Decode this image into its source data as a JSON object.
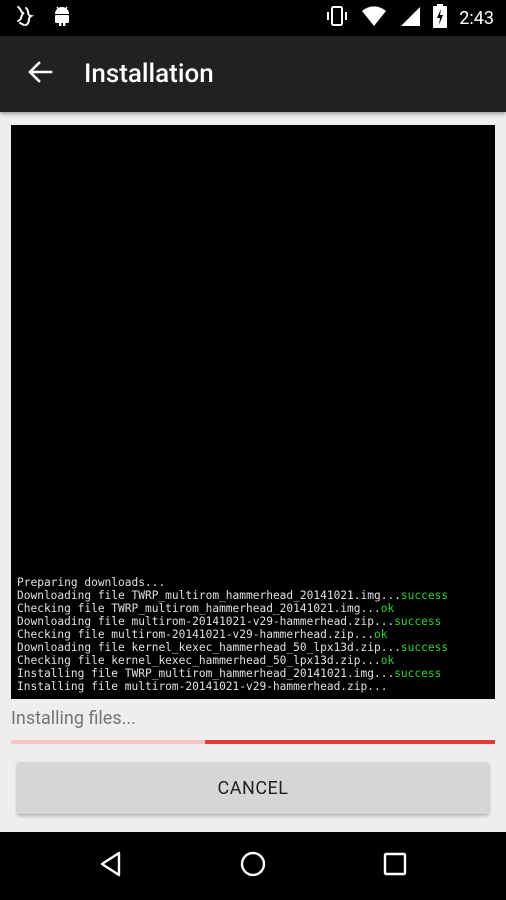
{
  "status_bar": {
    "time": "2:43",
    "left_icons": [
      "app-notification-icon",
      "android-debug-icon"
    ],
    "right_icons": [
      "vibrate-icon",
      "wifi-icon",
      "signal-icon",
      "battery-charging-icon"
    ]
  },
  "app_bar": {
    "title": "Installation",
    "back_icon": "arrow-back-icon"
  },
  "terminal": {
    "lines": [
      {
        "text": "Preparing downloads...",
        "status": ""
      },
      {
        "text": "Downloading file TWRP_multirom_hammerhead_20141021.img...",
        "status": "success"
      },
      {
        "text": "Checking file TWRP_multirom_hammerhead_20141021.img...",
        "status": "ok"
      },
      {
        "text": "Downloading file multirom-20141021-v29-hammerhead.zip...",
        "status": "success"
      },
      {
        "text": "Checking file multirom-20141021-v29-hammerhead.zip...",
        "status": "ok"
      },
      {
        "text": "Downloading file kernel_kexec_hammerhead_50_lpx13d.zip...",
        "status": "success"
      },
      {
        "text": "Checking file kernel_kexec_hammerhead_50_lpx13d.zip...",
        "status": "ok"
      },
      {
        "text": "Installing file TWRP_multirom_hammerhead_20141021.img...",
        "status": "success"
      },
      {
        "text": "Installing file multirom-20141021-v29-hammerhead.zip...",
        "status": ""
      }
    ]
  },
  "install": {
    "status_text": "Installing files...",
    "progress_secondary_fraction": 0.4
  },
  "cancel_label": "CANCEL",
  "nav": {
    "back": "nav-back-icon",
    "home": "nav-home-icon",
    "recents": "nav-recents-icon"
  },
  "colors": {
    "accent": "#e53935",
    "progress_track": "#f5c6c6",
    "log_success": "#2bd42b"
  }
}
